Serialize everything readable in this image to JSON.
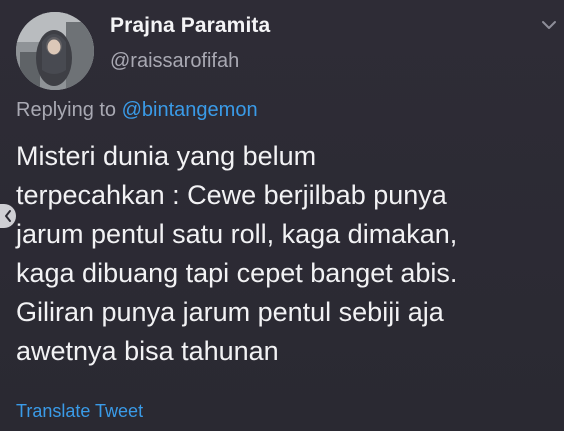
{
  "tweet": {
    "display_name": "Prajna Paramita",
    "handle": "@raissarofifah",
    "reply_prefix": "Replying to ",
    "reply_mention": "@bintangemon",
    "text": "Misteri dunia yang belum\nterpecahkan : Cewe berjilbab punya\njarum pentul satu roll, kaga dimakan,\nkaga dibuang tapi cepet banget abis.\nGiliran punya jarum pentul sebiji aja\nawetnya bisa tahunan",
    "translate_label": "Translate Tweet"
  },
  "colors": {
    "background": "#2b2a33",
    "link": "#3a9be8",
    "secondary_text": "#a9a9b3",
    "primary_text": "#f2f2f4"
  },
  "icons": {
    "menu": "chevron-down-icon",
    "back": "chevron-left-icon",
    "avatar": "avatar"
  }
}
